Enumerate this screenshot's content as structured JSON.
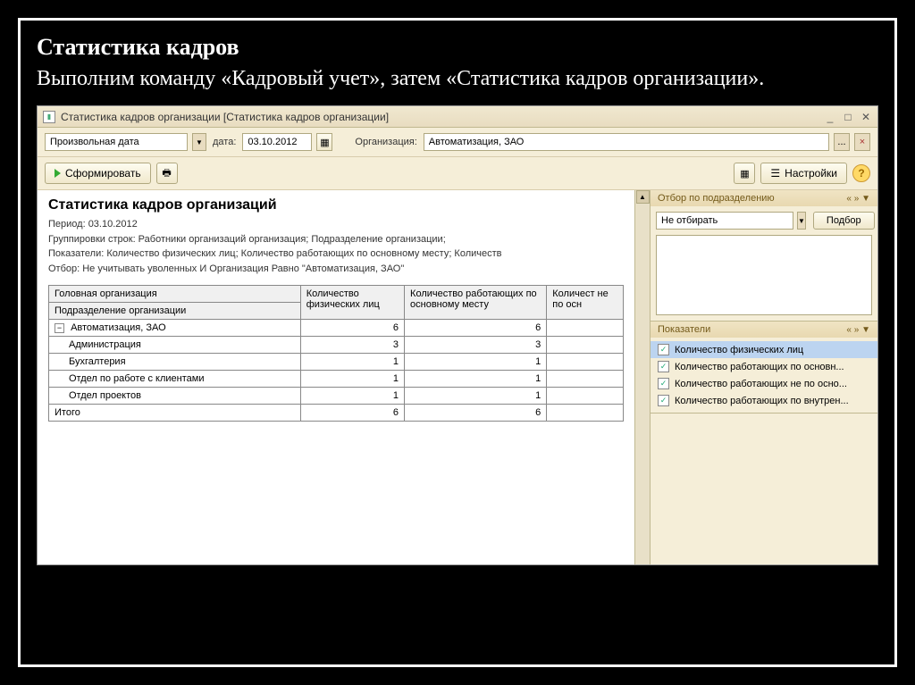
{
  "slide": {
    "title": "Статистика кадров",
    "subtitle": "Выполним команду «Кадровый учет», затем «Статистика кадров организации»."
  },
  "window": {
    "title": "Статистика кадров организации [Статистика кадров организации]"
  },
  "filters": {
    "period_mode": "Произвольная дата",
    "date_label": "дата:",
    "date_value": "03.10.2012",
    "org_label": "Организация:",
    "org_value": "Автоматизация, ЗАО"
  },
  "toolbar": {
    "form_button": "Сформировать",
    "settings_button": "Настройки"
  },
  "report": {
    "title": "Статистика кадров организаций",
    "period": "Период: 03.10.2012",
    "groupings": "Группировки строк: Работники организаций организация; Подразделение организации;",
    "indicators": "Показатели: Количество физических лиц; Количество работающих по основному месту; Количеств",
    "filter": "Отбор: Не учитывать уволенных И Организация Равно \"Автоматизация, ЗАО\"",
    "headers": {
      "col1a": "Головная организация",
      "col1b": "Подразделение организации",
      "col2": "Количество физических лиц",
      "col3": "Количество работающих по основному месту",
      "col4": "Количест не по осн"
    },
    "rows": [
      {
        "label": "Автоматизация, ЗАО",
        "c1": "6",
        "c2": "6",
        "c3": "",
        "level": 0,
        "toggle": true
      },
      {
        "label": "Администрация",
        "c1": "3",
        "c2": "3",
        "c3": "",
        "level": 1
      },
      {
        "label": "Бухгалтерия",
        "c1": "1",
        "c2": "1",
        "c3": "",
        "level": 1
      },
      {
        "label": "Отдел по работе с клиентами",
        "c1": "1",
        "c2": "1",
        "c3": "",
        "level": 1
      },
      {
        "label": "Отдел проектов",
        "c1": "1",
        "c2": "1",
        "c3": "",
        "level": 1
      }
    ],
    "total_label": "Итого",
    "total": {
      "c1": "6",
      "c2": "6",
      "c3": ""
    }
  },
  "side": {
    "panel1_title": "Отбор по подразделению",
    "filter_mode": "Не отбирать",
    "selection_btn": "Подбор",
    "panel2_title": "Показатели",
    "indicators": [
      {
        "label": "Количество физических лиц",
        "checked": true,
        "selected": true
      },
      {
        "label": "Количество работающих по основн...",
        "checked": true
      },
      {
        "label": "Количество работающих не по осно...",
        "checked": true
      },
      {
        "label": "Количество работающих по внутрен...",
        "checked": true
      }
    ]
  }
}
